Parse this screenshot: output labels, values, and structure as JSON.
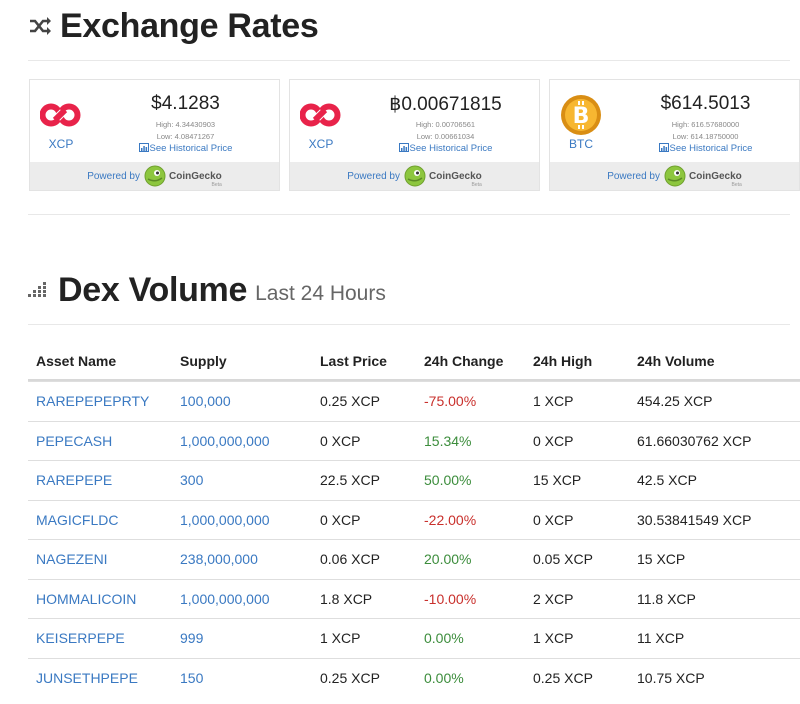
{
  "exchange": {
    "title": "Exchange Rates",
    "title_icon": "shuffle-icon",
    "powered_by": "Powered by",
    "coingecko": "CoinGecko",
    "beta": "Beta",
    "see_historical": "See Historical Price",
    "cards": [
      {
        "symbol": "XCP",
        "price": "$4.1283",
        "high": "High: 4.34430903",
        "low": "Low: 4.08471267",
        "logo": "counterparty-logo"
      },
      {
        "symbol": "XCP",
        "price": "฿0.00671815",
        "high": "High: 0.00706561",
        "low": "Low: 0.00661034",
        "logo": "counterparty-logo"
      },
      {
        "symbol": "BTC",
        "price": "$614.5013",
        "high": "High: 616.57680000",
        "low": "Low: 614.18750000",
        "logo": "bitcoin-logo"
      }
    ]
  },
  "dex": {
    "title": "Dex Volume",
    "subtitle": "Last 24 Hours",
    "title_icon": "bars-icon",
    "columns": [
      "Asset Name",
      "Supply",
      "Last Price",
      "24h Change",
      "24h High",
      "24h Volume"
    ],
    "rows": [
      {
        "asset": "RAREPEPEPRTY",
        "supply": "100,000",
        "last_price": "0.25 XCP",
        "change": "-75.00%",
        "high": "1 XCP",
        "volume": "454.25 XCP"
      },
      {
        "asset": "PEPECASH",
        "supply": "1,000,000,000",
        "last_price": "0 XCP",
        "change": "15.34%",
        "high": "0 XCP",
        "volume": "61.66030762 XCP"
      },
      {
        "asset": "RAREPEPE",
        "supply": "300",
        "last_price": "22.5 XCP",
        "change": "50.00%",
        "high": "15 XCP",
        "volume": "42.5 XCP"
      },
      {
        "asset": "MAGICFLDC",
        "supply": "1,000,000,000",
        "last_price": "0 XCP",
        "change": "-22.00%",
        "high": "0 XCP",
        "volume": "30.53841549 XCP"
      },
      {
        "asset": "NAGEZENI",
        "supply": "238,000,000",
        "last_price": "0.06 XCP",
        "change": "20.00%",
        "high": "0.05 XCP",
        "volume": "15 XCP"
      },
      {
        "asset": "HOMMALICOIN",
        "supply": "1,000,000,000",
        "last_price": "1.8 XCP",
        "change": "-10.00%",
        "high": "2 XCP",
        "volume": "11.8 XCP"
      },
      {
        "asset": "KEISERPEPE",
        "supply": "999",
        "last_price": "1 XCP",
        "change": "0.00%",
        "high": "1 XCP",
        "volume": "11 XCP"
      },
      {
        "asset": "JUNSETHPEPE",
        "supply": "150",
        "last_price": "0.25 XCP",
        "change": "0.00%",
        "high": "0.25 XCP",
        "volume": "10.75 XCP"
      }
    ]
  },
  "colors": {
    "link": "#3a79c2",
    "negative": "#c9302c",
    "positive": "#3c8d3c",
    "xcp_red": "#e8234a",
    "btc_gold": "#f0a81c"
  }
}
